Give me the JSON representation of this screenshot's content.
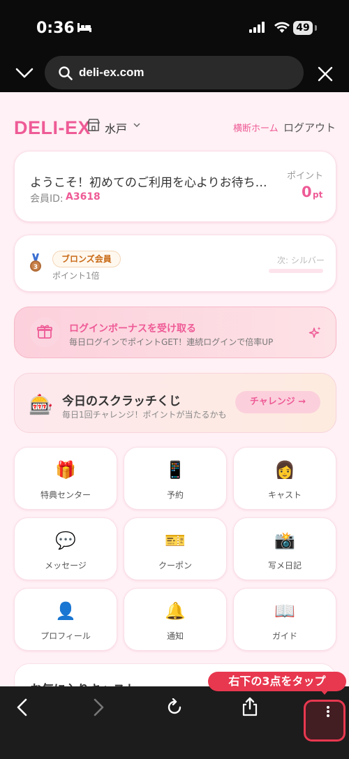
{
  "status_bar": {
    "time": "0:36",
    "battery": "49"
  },
  "browser": {
    "url": "deli-ex.com"
  },
  "header": {
    "brand": "DELI-EX",
    "region": "水戸",
    "cross_home": "横断ホーム",
    "logout": "ログアウト"
  },
  "welcome": {
    "message": "ようこそ！初めてのご利用を心よりお待ち…",
    "member_id_label": "会員ID:",
    "member_id": "A3618",
    "points_label": "ポイント",
    "points_value": "0",
    "points_unit": "pt"
  },
  "rank": {
    "badge": "ブロンズ会員",
    "multiplier": "ポイント1倍",
    "next": "次: シルバー",
    "progress": 0
  },
  "bonus": {
    "title": "ログインボーナスを受け取る",
    "subtitle": "毎日ログインでポイントGET！連続ログインで倍率UP"
  },
  "scratch": {
    "title": "今日のスクラッチくじ",
    "subtitle": "毎日1回チャレンジ！ポイントが当たるかも",
    "button": "チャレンジ →"
  },
  "menu": [
    {
      "emoji": "🎁",
      "label": "特典センター"
    },
    {
      "emoji": "📱",
      "label": "予約"
    },
    {
      "emoji": "👩",
      "label": "キャスト"
    },
    {
      "emoji": "💬",
      "label": "メッセージ"
    },
    {
      "emoji": "🎫",
      "label": "クーポン"
    },
    {
      "emoji": "📸",
      "label": "写メ日記"
    },
    {
      "emoji": "👤",
      "label": "プロフィール"
    },
    {
      "emoji": "🔔",
      "label": "通知"
    },
    {
      "emoji": "📖",
      "label": "ガイド"
    }
  ],
  "favorites": {
    "title": "お気に入りキャスト"
  },
  "tooltip": {
    "text": "右下の3点をタップ"
  },
  "colors": {
    "brand": "#ee5b96",
    "highlight": "#e8384f"
  }
}
